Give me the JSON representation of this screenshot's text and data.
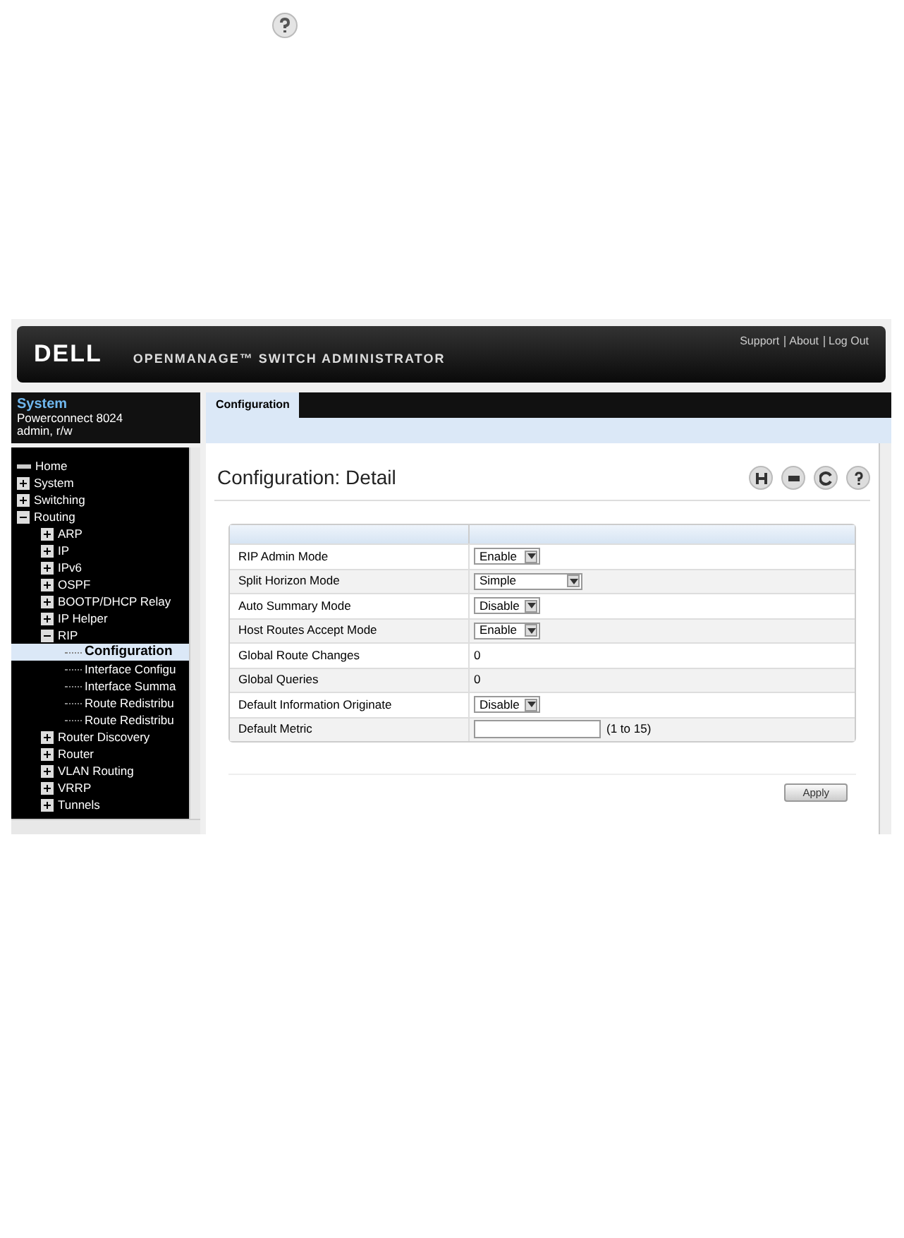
{
  "header": {
    "logo": "DELL",
    "product": "OPENMANAGE™ SWITCH ADMINISTRATOR",
    "links": [
      "Support",
      "About",
      "Log Out"
    ]
  },
  "system": {
    "title": "System",
    "model": "Powerconnect 8024",
    "user": "admin, r/w"
  },
  "tree": [
    {
      "label": "Home",
      "kind": "home",
      "selected": false
    },
    {
      "label": "System",
      "kind": "node",
      "expanded": false,
      "selected": false
    },
    {
      "label": "Switching",
      "kind": "node",
      "expanded": false,
      "selected": false
    },
    {
      "label": "Routing",
      "kind": "node",
      "expanded": true,
      "selected": false,
      "children": [
        {
          "label": "ARP",
          "kind": "node",
          "expanded": false,
          "selected": false
        },
        {
          "label": "IP",
          "kind": "node",
          "expanded": false,
          "selected": false
        },
        {
          "label": "IPv6",
          "kind": "node",
          "expanded": false,
          "selected": false
        },
        {
          "label": "OSPF",
          "kind": "node",
          "expanded": false,
          "selected": false
        },
        {
          "label": "BOOTP/DHCP Relay",
          "kind": "node",
          "expanded": false,
          "selected": false
        },
        {
          "label": "IP Helper",
          "kind": "node",
          "expanded": false,
          "selected": false
        },
        {
          "label": "RIP",
          "kind": "node",
          "expanded": true,
          "selected": false,
          "children": [
            {
              "label": "Configuration",
              "kind": "page",
              "selected": true
            },
            {
              "label": "Interface Configu",
              "kind": "page",
              "selected": false
            },
            {
              "label": "Interface Summa",
              "kind": "page",
              "selected": false
            },
            {
              "label": "Route Redistribu",
              "kind": "page",
              "selected": false
            },
            {
              "label": "Route Redistribu",
              "kind": "page",
              "selected": false
            }
          ]
        },
        {
          "label": "Router Discovery",
          "kind": "node",
          "expanded": false,
          "selected": false
        },
        {
          "label": "Router",
          "kind": "node",
          "expanded": false,
          "selected": false
        },
        {
          "label": "VLAN Routing",
          "kind": "node",
          "expanded": false,
          "selected": false
        },
        {
          "label": "VRRP",
          "kind": "node",
          "expanded": false,
          "selected": false
        },
        {
          "label": "Tunnels",
          "kind": "node",
          "expanded": false,
          "selected": false
        }
      ]
    }
  ],
  "tabs": [
    {
      "label": "Configuration",
      "selected": true
    }
  ],
  "page_title": "Configuration: Detail",
  "rows": [
    {
      "label": "RIP Admin Mode",
      "kind": "select",
      "value": "Enable",
      "wide": false
    },
    {
      "label": "Split Horizon Mode",
      "kind": "select",
      "value": "Simple",
      "wide": true
    },
    {
      "label": "Auto Summary Mode",
      "kind": "select",
      "value": "Disable",
      "wide": false
    },
    {
      "label": "Host Routes Accept Mode",
      "kind": "select",
      "value": "Enable",
      "wide": false
    },
    {
      "label": "Global Route Changes",
      "kind": "text",
      "value": "0"
    },
    {
      "label": "Global Queries",
      "kind": "text",
      "value": "0"
    },
    {
      "label": "Default Information Originate",
      "kind": "select",
      "value": "Disable",
      "wide": false
    },
    {
      "label": "Default Metric",
      "kind": "input",
      "hint": "(1 to 15)"
    }
  ],
  "apply_button": "Apply"
}
